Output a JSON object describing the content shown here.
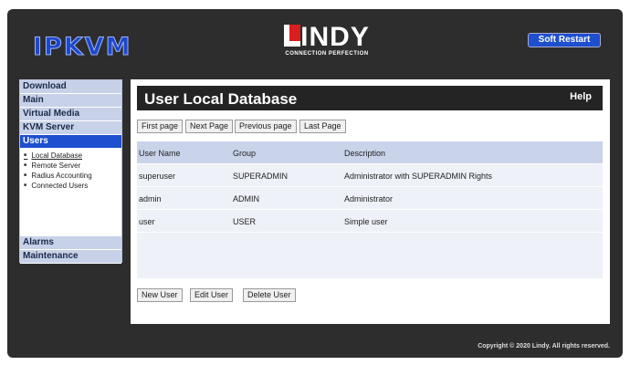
{
  "header": {
    "product_logo": "IPKVM",
    "brand_logo": "LINDY",
    "brand_tagline": "CONNECTION PERFECTION",
    "soft_restart": "Soft Restart"
  },
  "sidebar": {
    "items": [
      {
        "label": "Download"
      },
      {
        "label": "Main"
      },
      {
        "label": "Virtual Media"
      },
      {
        "label": "KVM Server"
      },
      {
        "label": "Users"
      }
    ],
    "subitems": [
      "Local Database",
      "Remote Server",
      "Radius Accounting",
      "Connected Users"
    ],
    "bottom_items": [
      {
        "label": "Alarms"
      },
      {
        "label": "Maintenance"
      }
    ]
  },
  "main": {
    "title": "User Local Database",
    "help": "Help",
    "pager": [
      "First page",
      "Next Page",
      "Previous page",
      "Last Page"
    ],
    "columns": [
      "User Name",
      "Group",
      "Description"
    ],
    "rows": [
      [
        "superuser",
        "SUPERADMIN",
        "Administrator with SUPERADMIN Rights"
      ],
      [
        "admin",
        "ADMIN",
        "Administrator"
      ],
      [
        "user",
        "USER",
        "Simple user"
      ]
    ],
    "actions": [
      "New User",
      "Edit User",
      "Delete User"
    ]
  },
  "footer": "Copyright © 2020 Lindy. All rights reserved."
}
